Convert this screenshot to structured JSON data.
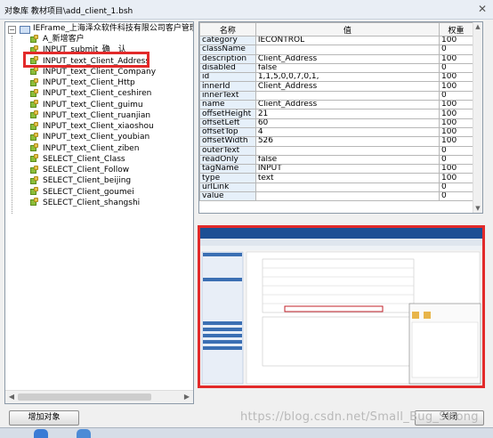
{
  "window": {
    "title": "对象库 教材项目\\add_client_1.bsh",
    "close_label": "✕"
  },
  "tree": {
    "root_label": "IEFrame_上海泽众软件科技有限公司客户管理系",
    "expander": "−",
    "items": [
      {
        "label": "A_新增客户"
      },
      {
        "label": "INPUT_submit_确　认"
      },
      {
        "label": "INPUT_text_Client_Address"
      },
      {
        "label": "INPUT_text_Client_Company"
      },
      {
        "label": "INPUT_text_Client_Http"
      },
      {
        "label": "INPUT_text_Client_ceshiren"
      },
      {
        "label": "INPUT_text_Client_guimu"
      },
      {
        "label": "INPUT_text_Client_ruanjian"
      },
      {
        "label": "INPUT_text_Client_xiaoshou"
      },
      {
        "label": "INPUT_text_Client_youbian"
      },
      {
        "label": "INPUT_text_Client_ziben"
      },
      {
        "label": "SELECT_Client_Class"
      },
      {
        "label": "SELECT_Client_Follow"
      },
      {
        "label": "SELECT_Client_beijing"
      },
      {
        "label": "SELECT_Client_goumei"
      },
      {
        "label": "SELECT_Client_shangshi"
      }
    ],
    "selected_index": 2
  },
  "properties": {
    "headers": [
      "名称",
      "值",
      "权重"
    ],
    "rows": [
      {
        "name": "category",
        "value": "IECONTROL",
        "weight": "100"
      },
      {
        "name": "className",
        "value": "",
        "weight": "0"
      },
      {
        "name": "description",
        "value": "Client_Address",
        "weight": "100"
      },
      {
        "name": "disabled",
        "value": "false",
        "weight": "0"
      },
      {
        "name": "id",
        "value": "1,1,5,0,0,7,0,1,",
        "weight": "100"
      },
      {
        "name": "innerId",
        "value": "Client_Address",
        "weight": "100"
      },
      {
        "name": "innerText",
        "value": "",
        "weight": "0"
      },
      {
        "name": "name",
        "value": "Client_Address",
        "weight": "100"
      },
      {
        "name": "offsetHeight",
        "value": "21",
        "weight": "100"
      },
      {
        "name": "offsetLeft",
        "value": "60",
        "weight": "100"
      },
      {
        "name": "offsetTop",
        "value": "4",
        "weight": "100"
      },
      {
        "name": "offsetWidth",
        "value": "526",
        "weight": "100"
      },
      {
        "name": "outerText",
        "value": "",
        "weight": "0"
      },
      {
        "name": "readOnly",
        "value": "false",
        "weight": "0"
      },
      {
        "name": "tagName",
        "value": "INPUT",
        "weight": "100"
      },
      {
        "name": "type",
        "value": "text",
        "weight": "100"
      },
      {
        "name": "urlLink",
        "value": "",
        "weight": "0"
      },
      {
        "name": "value",
        "value": "",
        "weight": "0"
      }
    ]
  },
  "buttons": {
    "add_object": "增加对象",
    "close": "关闭"
  },
  "watermark": "https://blog.csdn.net/Small_Bug_Strong",
  "colors": {
    "highlight": "#e22a2a",
    "grid_name_bg": "#e6f0fa"
  }
}
